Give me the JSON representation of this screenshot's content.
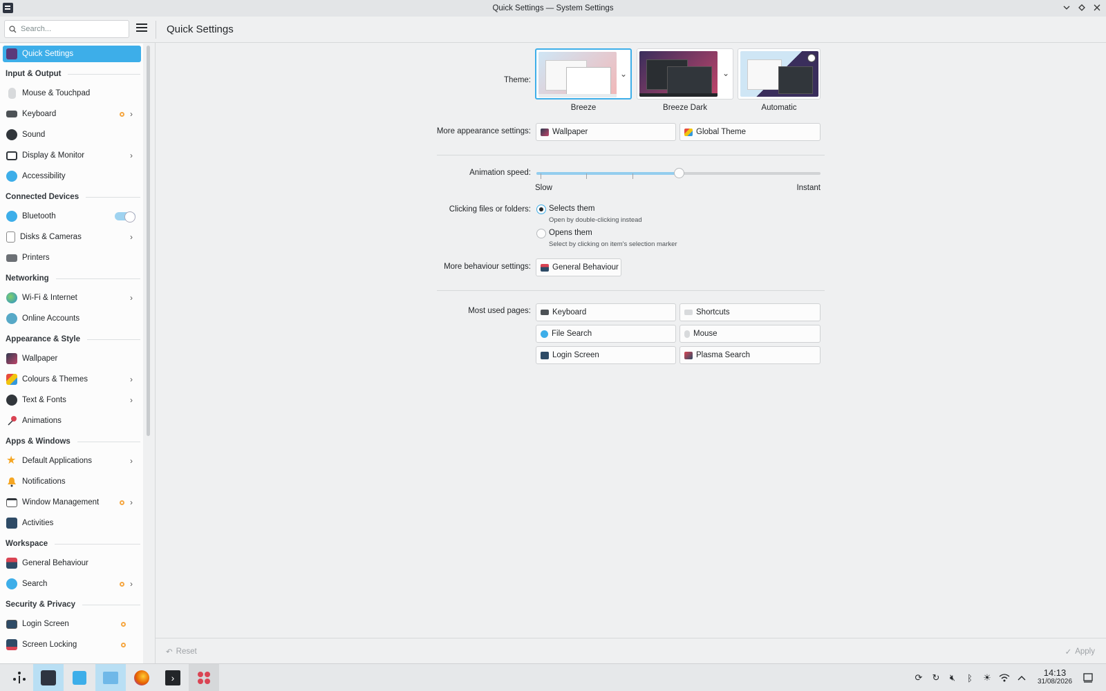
{
  "window": {
    "title": "Quick Settings — System Settings"
  },
  "header": {
    "search_placeholder": "Search...",
    "page_title": "Quick Settings"
  },
  "sidebar": {
    "active": {
      "label": "Quick Settings",
      "icon": "quick-settings-icon"
    },
    "sections": {
      "input_output": "Input & Output",
      "connected_devices": "Connected Devices",
      "networking": "Networking",
      "appearance_style": "Appearance & Style",
      "apps_windows": "Apps & Windows",
      "workspace": "Workspace",
      "security_privacy": "Security & Privacy"
    },
    "items": {
      "mouse_touchpad": "Mouse & Touchpad",
      "keyboard": "Keyboard",
      "sound": "Sound",
      "display_monitor": "Display & Monitor",
      "accessibility": "Accessibility",
      "bluetooth": "Bluetooth",
      "disks_cameras": "Disks & Cameras",
      "printers": "Printers",
      "wifi_internet": "Wi-Fi & Internet",
      "online_accounts": "Online Accounts",
      "wallpaper": "Wallpaper",
      "colours_themes": "Colours & Themes",
      "text_fonts": "Text & Fonts",
      "animations": "Animations",
      "default_applications": "Default Applications",
      "notifications": "Notifications",
      "window_management": "Window Management",
      "activities": "Activities",
      "general_behaviour": "General Behaviour",
      "search": "Search",
      "login_screen": "Login Screen",
      "screen_locking": "Screen Locking"
    },
    "bluetooth_enabled": true
  },
  "main": {
    "theme_label": "Theme:",
    "themes": [
      {
        "name": "Breeze",
        "selected": true
      },
      {
        "name": "Breeze Dark",
        "selected": false
      },
      {
        "name": "Automatic",
        "selected": false
      }
    ],
    "more_appearance_label": "More appearance settings:",
    "appearance_buttons": {
      "wallpaper": "Wallpaper",
      "global_theme": "Global Theme"
    },
    "animation_label": "Animation speed:",
    "animation_slow": "Slow",
    "animation_instant": "Instant",
    "animation_value_fraction": 0.5,
    "clicking_label": "Clicking files or folders:",
    "selects_them": "Selects them",
    "selects_hint": "Open by double-clicking instead",
    "opens_them": "Opens them",
    "opens_hint": "Select by clicking on item's selection marker",
    "clicking_selected": "selects",
    "more_behaviour_label": "More behaviour settings:",
    "general_behaviour_btn": "General Behaviour",
    "most_used_label": "Most used pages:",
    "most_used": {
      "keyboard": "Keyboard",
      "shortcuts": "Shortcuts",
      "file_search": "File Search",
      "mouse": "Mouse",
      "login_screen": "Login Screen",
      "plasma_search": "Plasma Search"
    }
  },
  "footer": {
    "reset": "Reset",
    "apply": "Apply"
  },
  "taskbar": {
    "time": "14:13",
    "date": "31/08/2026"
  },
  "colors": {
    "accent": "#3daee9",
    "notification_dot": "#f5a640"
  }
}
